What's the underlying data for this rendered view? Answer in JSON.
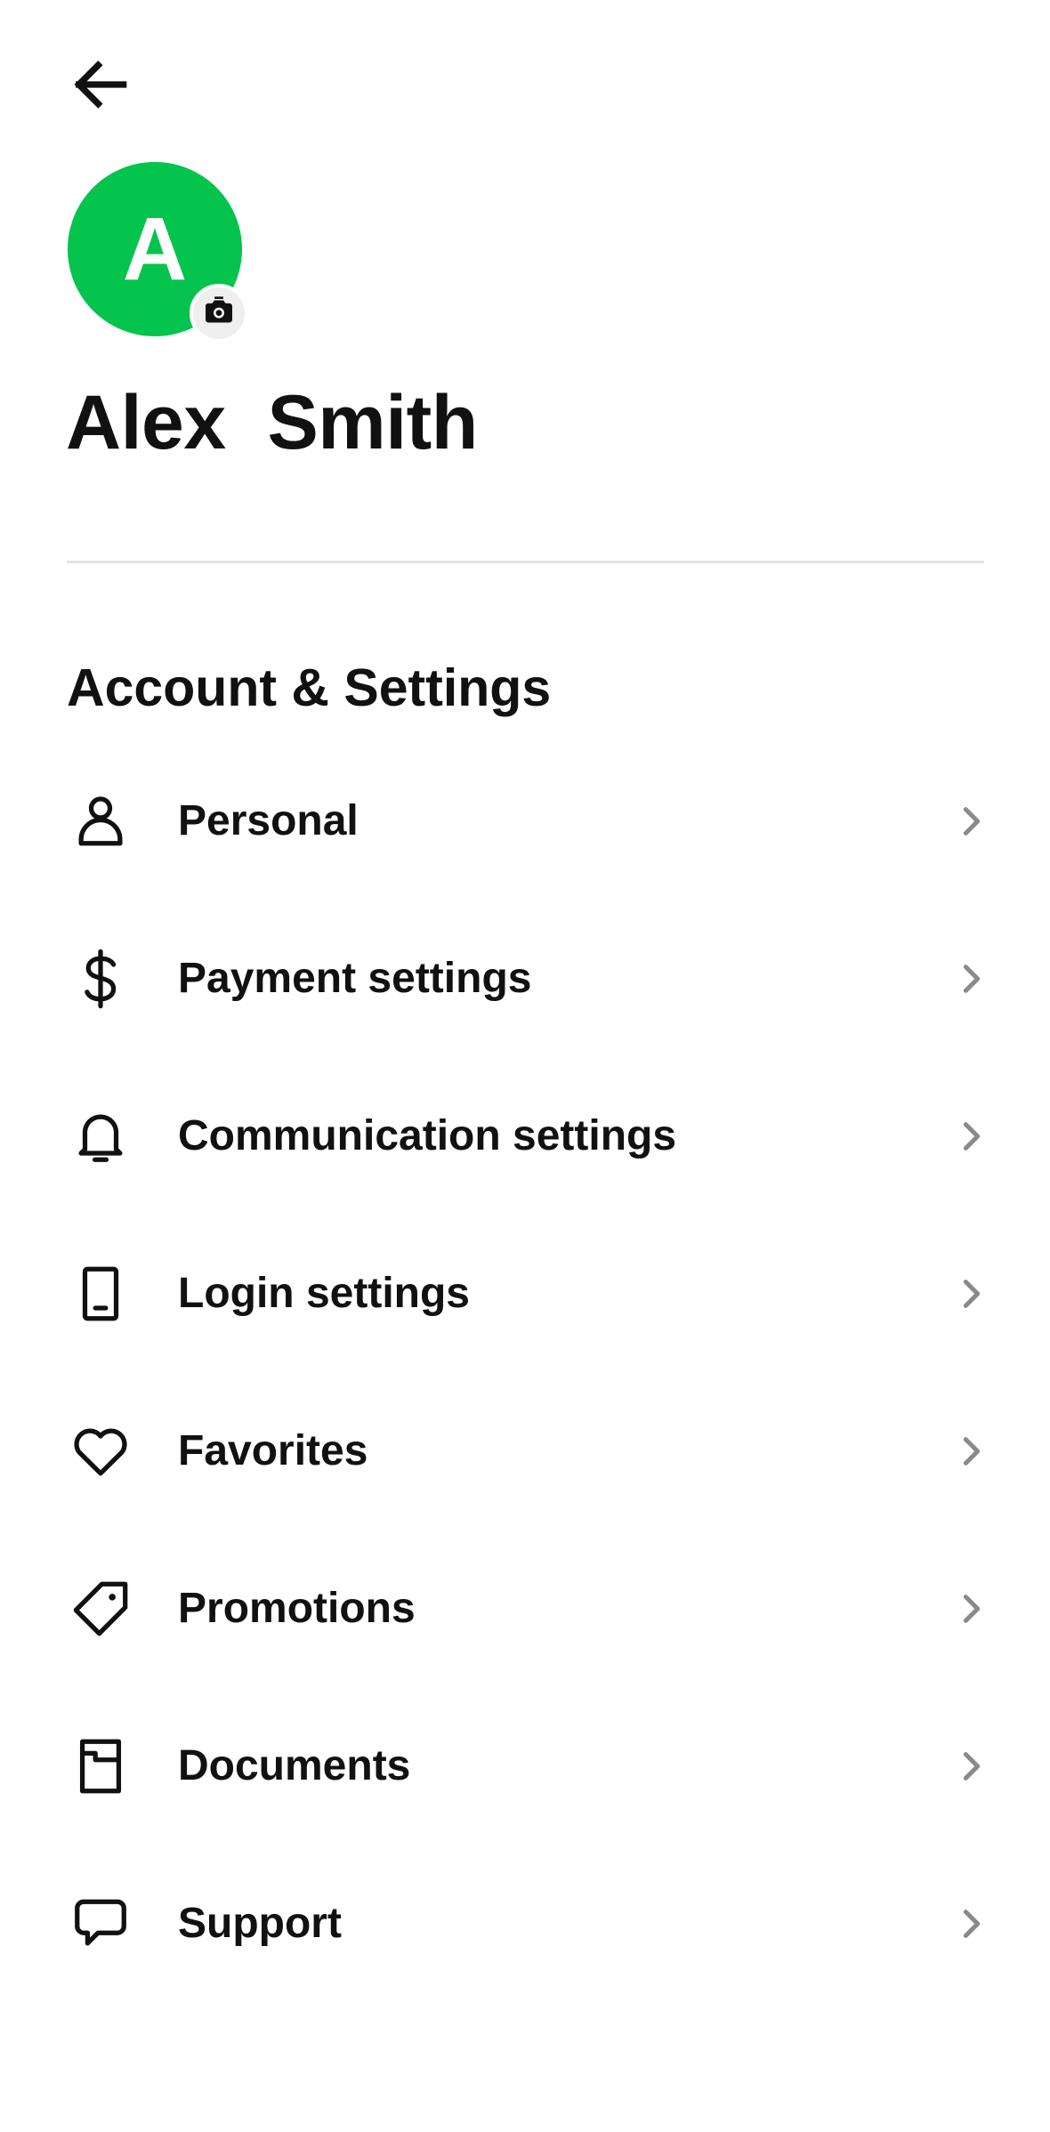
{
  "header": {
    "back_icon": "arrow-left-icon"
  },
  "profile": {
    "avatar_initial": "A",
    "avatar_color": "#05c44e",
    "camera_icon": "camera-icon",
    "name": "Alex  Smith"
  },
  "section": {
    "title": "Account & Settings"
  },
  "menu": {
    "items": [
      {
        "label": "Personal",
        "icon": "person-icon"
      },
      {
        "label": "Payment settings",
        "icon": "dollar-icon"
      },
      {
        "label": "Communication settings",
        "icon": "bell-icon"
      },
      {
        "label": "Login settings",
        "icon": "phone-icon"
      },
      {
        "label": "Favorites",
        "icon": "heart-icon"
      },
      {
        "label": "Promotions",
        "icon": "tag-icon"
      },
      {
        "label": "Documents",
        "icon": "document-icon"
      },
      {
        "label": "Support",
        "icon": "chat-bubble-icon"
      }
    ],
    "chevron_icon": "chevron-right-icon"
  }
}
